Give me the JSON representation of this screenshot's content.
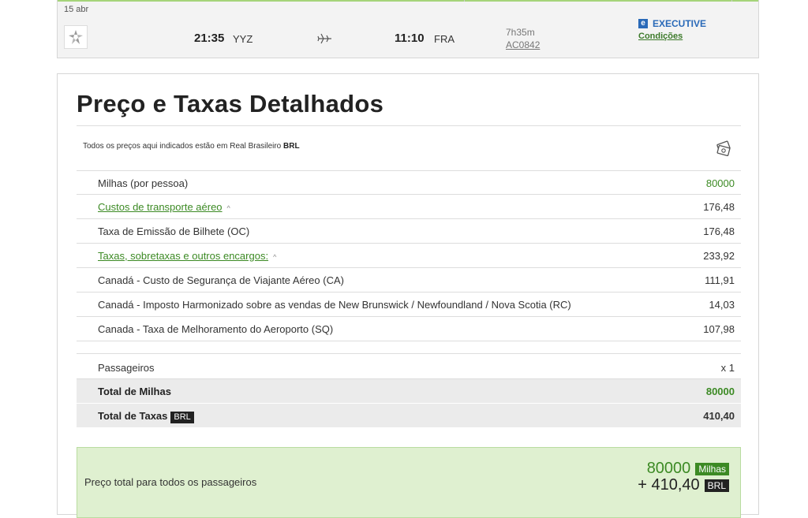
{
  "flight": {
    "date": "15 abr",
    "departure_time": "21:35",
    "departure_code": "YYZ",
    "arrival_time": "11:10",
    "arrival_code": "FRA",
    "duration": "7h35m",
    "flight_number": "AC0842",
    "cabin_badge": "e",
    "cabin": "EXECUTIVE",
    "conditions_link": "Condições",
    "icons": {
      "airline": "star-alliance-logo-icon",
      "plane": "plane-icon"
    }
  },
  "price": {
    "title": "Preço e Taxas Detalhados",
    "currency_note_prefix": "Todos os preços aqui indicados estão em Real Brasileiro",
    "currency_code": "BRL",
    "currency_icon": "money-exchange-icon",
    "rows": [
      {
        "label": "Milhas (por pessoa)",
        "value": "80000"
      },
      {
        "label": "Custos de transporte aéreo",
        "value": "176,48",
        "caret": "^"
      },
      {
        "label": "Taxa de Emissão de Bilhete (OC)",
        "value": "176,48"
      },
      {
        "label": "Taxas, sobretaxas e outros encargos:",
        "value": "233,92",
        "caret": "^"
      },
      {
        "label": "Canadá - Custo de Segurança de Viajante Aéreo (CA)",
        "value": "111,91"
      },
      {
        "label": "Canadá - Imposto Harmonizado sobre as vendas de New Brunswick / Newfoundland / Nova Scotia (RC)",
        "value": "14,03"
      },
      {
        "label": "Canada - Taxa de Melhoramento do Aeroporto (SQ)",
        "value": "107,98"
      }
    ],
    "passengers_label": "Passageiros",
    "passengers_value": "x 1",
    "total_miles_label": "Total de Milhas",
    "total_miles_value": "80000",
    "total_taxes_label": "Total de Taxas",
    "total_taxes_tag": "BRL",
    "total_taxes_value": "410,40",
    "grand_total_label": "Preço total para todos os passageiros",
    "grand_total_miles": "80000",
    "grand_total_miles_tag": "Milhas",
    "grand_total_money": "+ 410,40",
    "grand_total_money_tag": "BRL"
  },
  "colors": {
    "accent_green": "#3c8a24",
    "cabin_blue": "#2a6ab8",
    "total_bg": "#dff0d0"
  }
}
